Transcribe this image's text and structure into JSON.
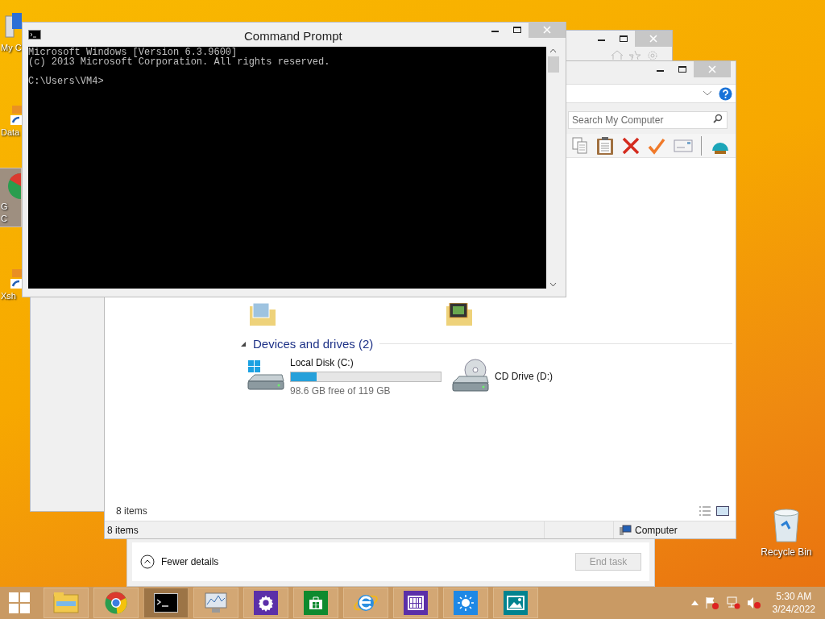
{
  "desktop_icons": [
    {
      "kind": "computer",
      "lines": [
        "My C"
      ],
      "selected": false
    },
    {
      "kind": "shortcut",
      "lines": [
        "Data"
      ],
      "selected": false
    },
    {
      "kind": "chrome",
      "lines": [
        "G",
        "C"
      ],
      "selected": true
    },
    {
      "kind": "shortcut",
      "lines": [
        "Xsh"
      ],
      "selected": false
    }
  ],
  "recycle_bin": {
    "label": "Recycle Bin"
  },
  "command_prompt": {
    "title": "Command Prompt",
    "banner": [
      "Microsoft Windows [Version 6.3.9600]",
      "(c) 2013 Microsoft Corporation. All rights reserved."
    ],
    "prompt": "C:\\Users\\VM4>"
  },
  "explorer": {
    "search": {
      "placeholder": "Search My Computer"
    },
    "group": {
      "label": "Devices and drives (2)",
      "expanded": true
    },
    "drives": [
      {
        "kind": "disk",
        "name": "Local Disk (C:)",
        "level": 0.17,
        "reading": "98.6 GB free of 119 GB"
      },
      {
        "kind": "cd",
        "name": "CD Drive (D:)"
      }
    ],
    "items_count": "8 items",
    "status_bar": {
      "items": "8 items",
      "location": "Computer"
    }
  },
  "task_manager": {
    "details_toggle": "Fewer details",
    "end_task": {
      "label": "End task",
      "disabled": true
    }
  },
  "taskbar": {
    "apps": [
      {
        "kind": "explorer",
        "selected": false
      },
      {
        "kind": "chrome",
        "selected": false
      },
      {
        "kind": "cmd",
        "selected": true
      },
      {
        "kind": "monitor",
        "selected": false
      },
      {
        "kind": "settings",
        "selected": false
      },
      {
        "kind": "store",
        "selected": false
      },
      {
        "kind": "ie",
        "selected": false
      },
      {
        "kind": "calculator",
        "selected": false
      },
      {
        "kind": "weather",
        "selected": false
      },
      {
        "kind": "photos",
        "selected": false
      }
    ],
    "time": "5:30 AM",
    "date": "3/24/2022"
  }
}
